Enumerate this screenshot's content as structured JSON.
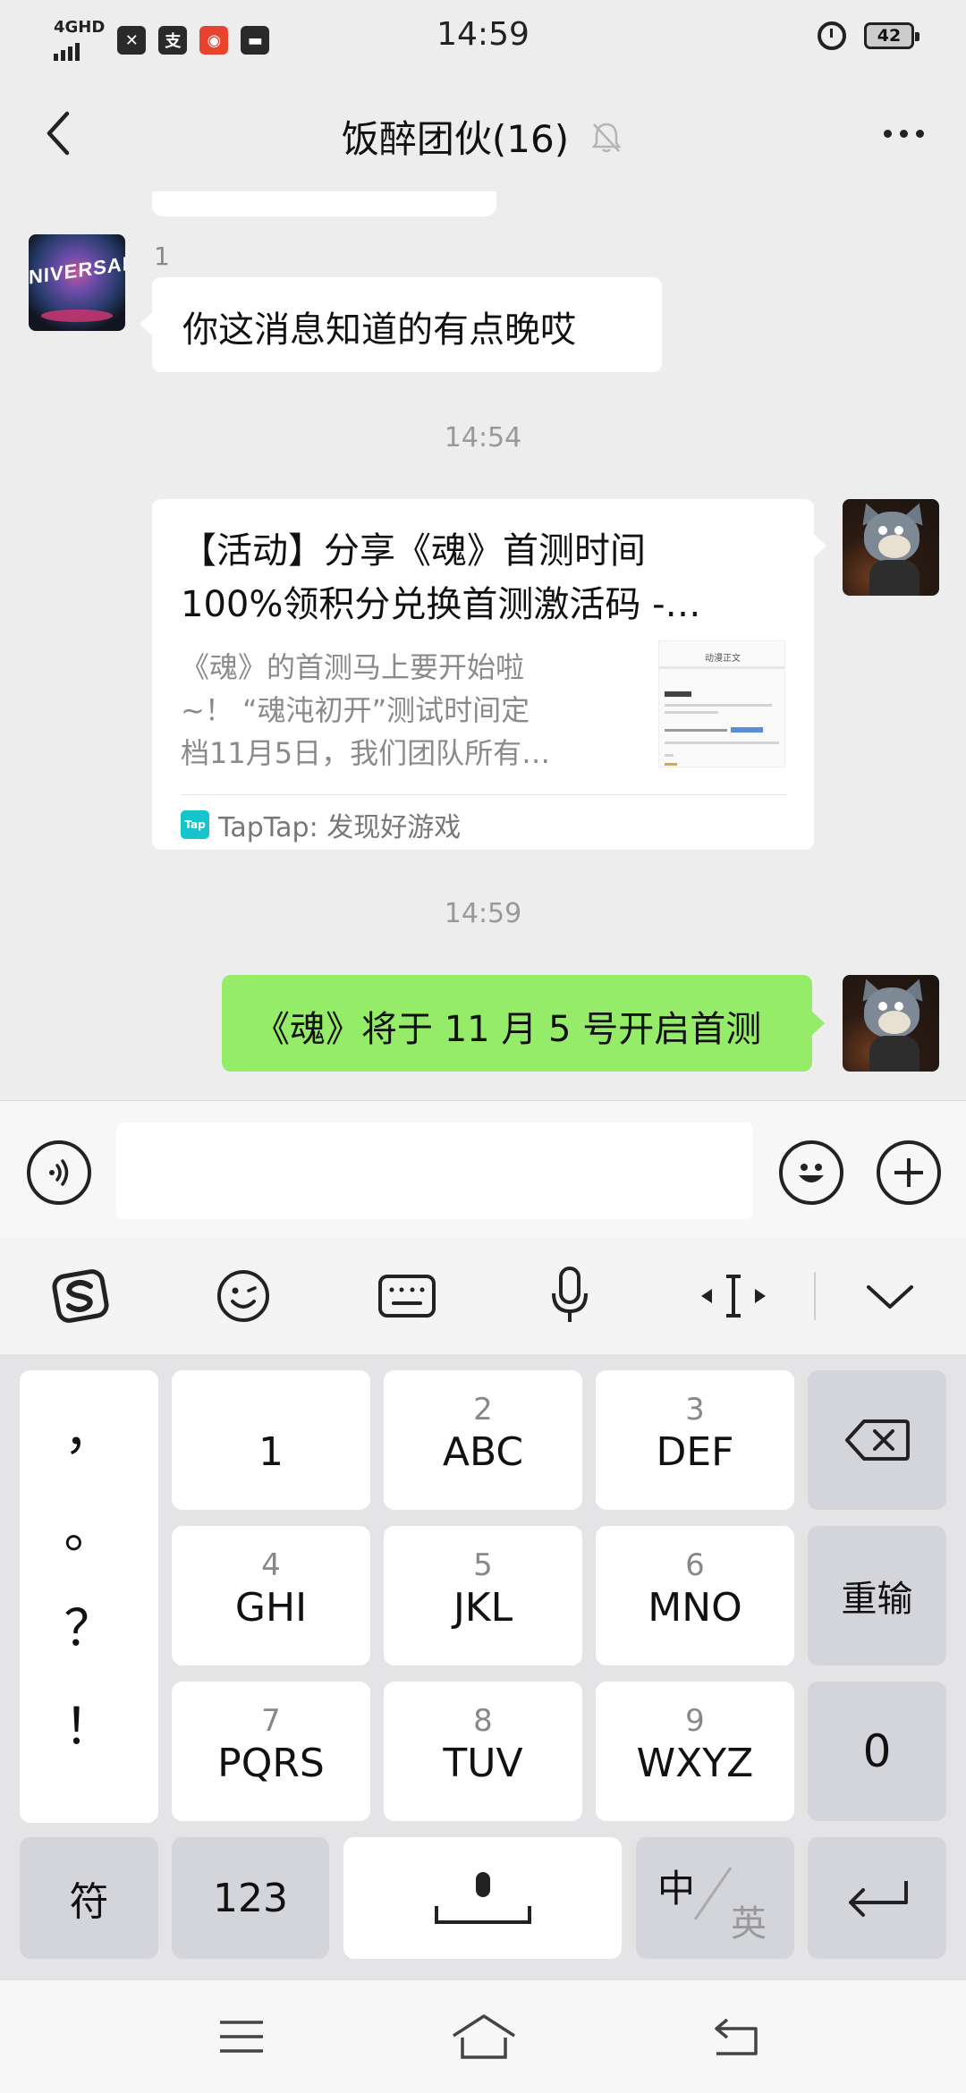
{
  "status_bar": {
    "network": "4GHD",
    "time": "14:59",
    "battery": "42"
  },
  "header": {
    "title": "饭醉团伙(16)"
  },
  "chat": {
    "incoming": {
      "sender": "1",
      "text": "你这消息知道的有点晚哎",
      "avatar_text": "NIVERSAL"
    },
    "timestamp_1": "14:54",
    "card": {
      "title_line1": "【活动】分享《魂》首测时间",
      "title_line2": "100%领积分兑换首测激活码 -…",
      "desc_line1": "《魂》的首测马上要开始啦",
      "desc_line2": "~！ “魂沌初开”测试时间定",
      "desc_line3": "档11月5日，我们团队所有…",
      "thumb_title": "动漫正文",
      "source": "TapTap: 发现好游戏",
      "source_icon": "Tap"
    },
    "timestamp_2": "14:59",
    "outgoing": {
      "text": "《魂》将于 11 月 5 号开启首测"
    }
  },
  "input_bar": {
    "value": ""
  },
  "keyboard": {
    "punct": [
      "，",
      "。",
      "？",
      "！"
    ],
    "keys": {
      "k1": {
        "main": "1"
      },
      "k2": {
        "num": "2",
        "main": "ABC"
      },
      "k3": {
        "num": "3",
        "main": "DEF"
      },
      "k4": {
        "num": "4",
        "main": "GHI"
      },
      "k5": {
        "num": "5",
        "main": "JKL"
      },
      "k6": {
        "num": "6",
        "main": "MNO"
      },
      "k7": {
        "num": "7",
        "main": "PQRS"
      },
      "k8": {
        "num": "8",
        "main": "TUV"
      },
      "k9": {
        "num": "9",
        "main": "WXYZ"
      },
      "reenter": "重输",
      "zero": "0",
      "symbols": "符",
      "num_mode": "123",
      "lang_zh": "中",
      "lang_en": "英"
    }
  },
  "colors": {
    "outgoing_bubble": "#95ec69",
    "background": "#ededed",
    "tap_icon": "#15c5ce"
  }
}
